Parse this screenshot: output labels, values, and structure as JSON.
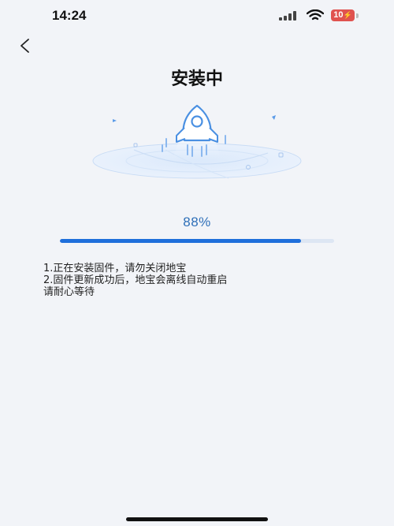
{
  "status_bar": {
    "time": "14:24",
    "battery_level": "10"
  },
  "header": {
    "title": "安装中"
  },
  "progress": {
    "percent_text": "88%",
    "value": 0.88,
    "fill_color": "#1f6fdb",
    "text_color": "#2e6fb8"
  },
  "notes": [
    "1.正在安装固件，请勿关闭地宝",
    "2.固件更新成功后，地宝会离线自动重启",
    "请耐心等待"
  ],
  "icons": {
    "back": "chevron-left-icon",
    "illustration": "rocket-icon"
  }
}
